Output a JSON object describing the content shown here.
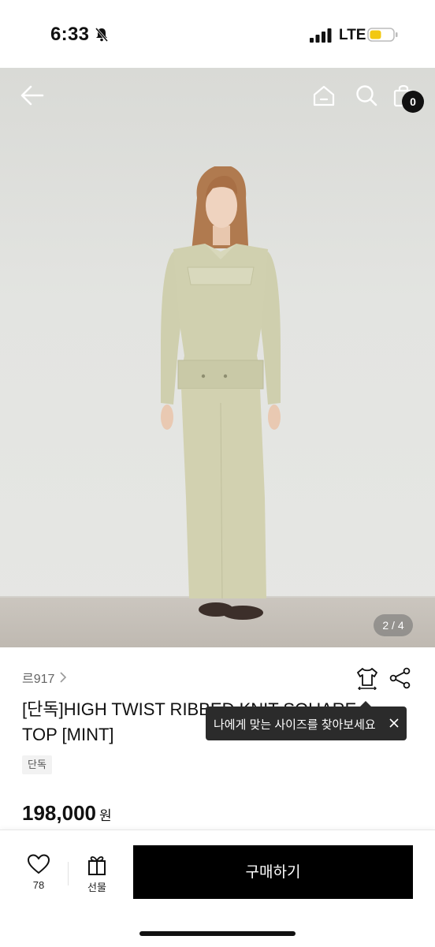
{
  "status_bar": {
    "time": "6:33",
    "network": "LTE"
  },
  "hero": {
    "image_counter": "2 / 4",
    "cart_count": "0"
  },
  "product": {
    "brand": "르917",
    "title": "[단독]HIGH TWIST RIBBED KNIT SQUARE TOP [MINT]",
    "tag": "단독",
    "price": "198,000",
    "price_unit": "원"
  },
  "tooltip": {
    "text": "나에게 맞는 사이즈를 찾아보세요"
  },
  "bottom_bar": {
    "like_count": "78",
    "gift_label": "선물",
    "buy_label": "구매하기"
  },
  "colors": {
    "accent": "#000000",
    "tooltip_bg": "#2b2b2b",
    "knit_mint": "#cfcfae"
  }
}
